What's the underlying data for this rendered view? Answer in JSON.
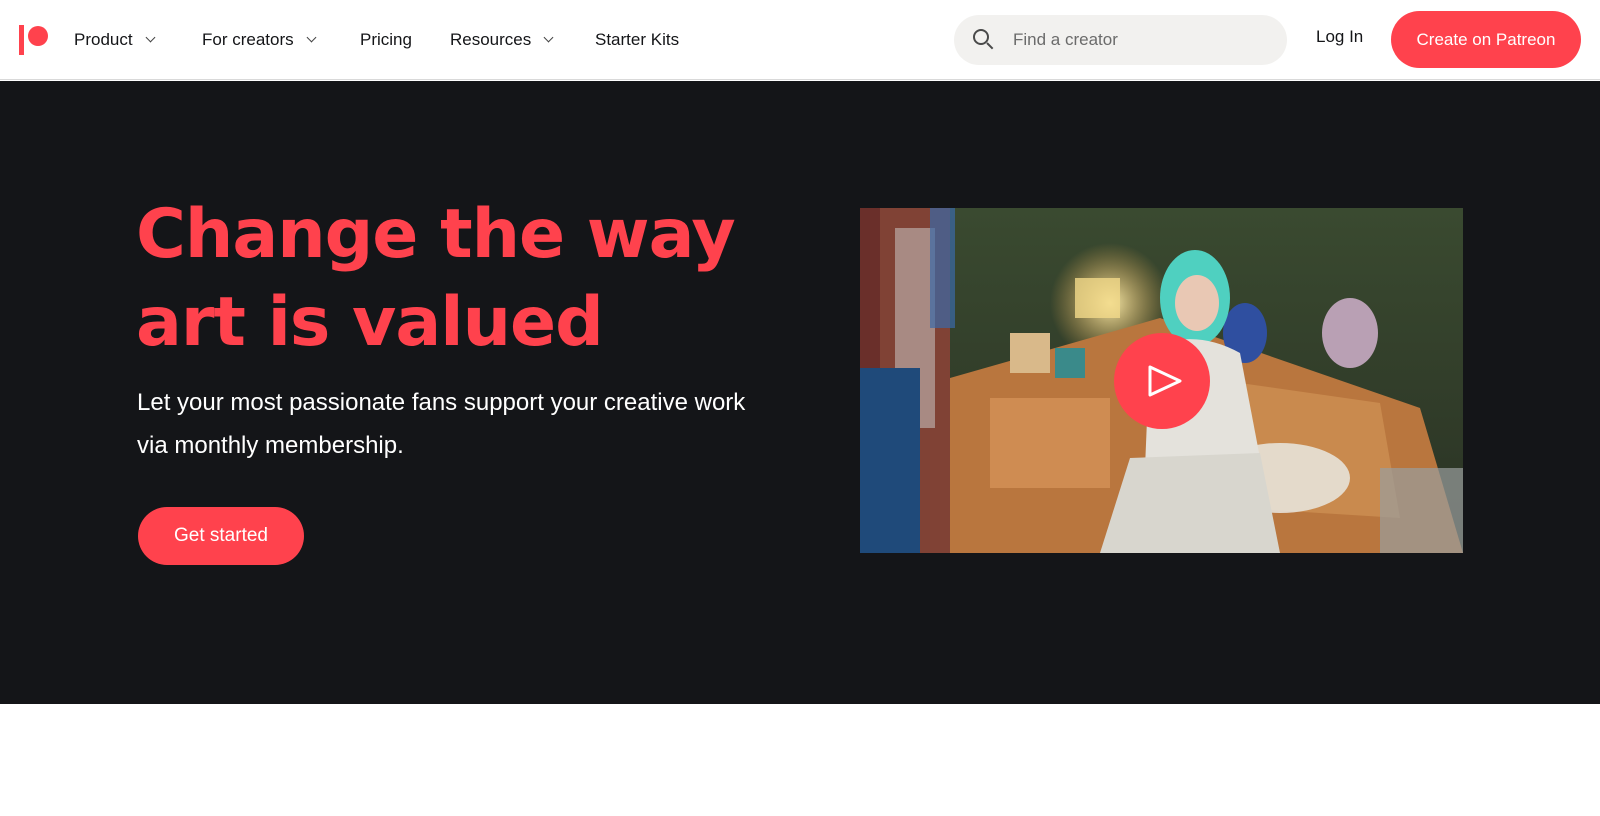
{
  "nav": {
    "logo_icon": "patreon-logo",
    "items": [
      {
        "label": "Product",
        "dropdown": true
      },
      {
        "label": "For creators",
        "dropdown": true
      },
      {
        "label": "Pricing",
        "dropdown": false
      },
      {
        "label": "Resources",
        "dropdown": true
      },
      {
        "label": "Starter Kits",
        "dropdown": false
      }
    ],
    "search": {
      "placeholder": "Find a creator",
      "value": "",
      "icon": "search-icon"
    },
    "login_label": "Log In",
    "cta_label": "Create on Patreon"
  },
  "hero": {
    "headline_line1": "Change the way",
    "headline_line2": "art is valued",
    "subtext": "Let your most passionate fans support your creative work via monthly membership.",
    "cta_label": "Get started",
    "video": {
      "play_icon": "play-icon"
    }
  },
  "colors": {
    "brand": "#ff424d",
    "hero_bg": "#141518",
    "text_dark": "#141518",
    "search_bg": "#f2f1ef"
  }
}
